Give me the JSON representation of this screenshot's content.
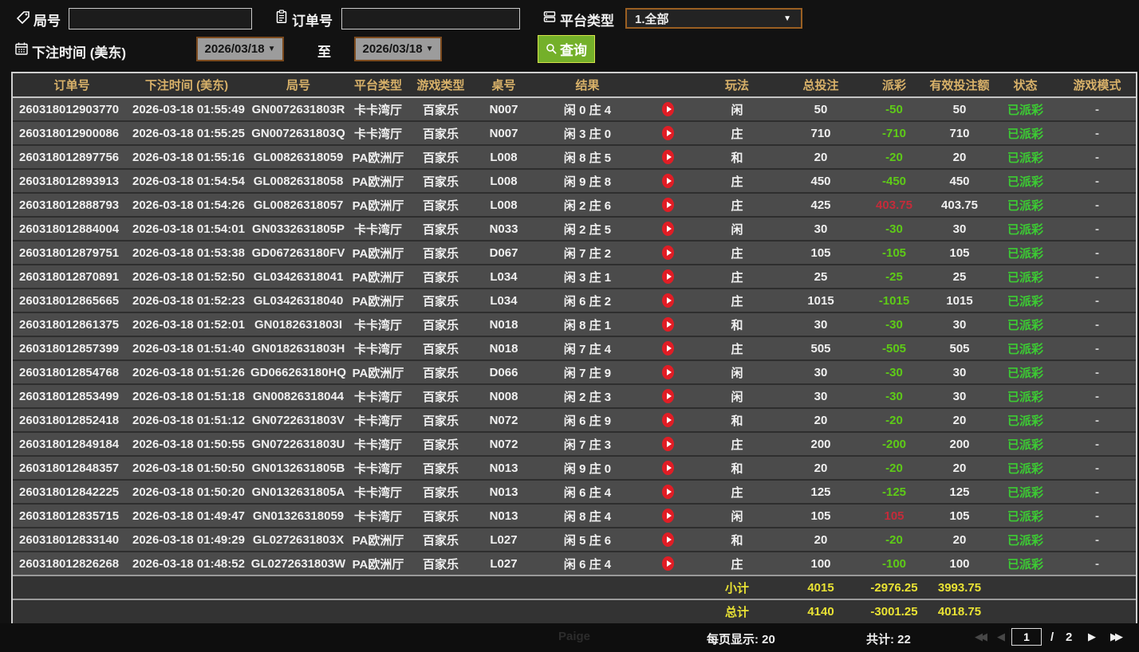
{
  "filters": {
    "game_no_label": "局号",
    "game_no_value": "",
    "order_no_label": "订单号",
    "order_no_value": "",
    "platform_label": "平台类型",
    "platform_value": "1.全部",
    "bet_time_label": "下注时间 (美东)",
    "date_from": "2026/03/18",
    "to_label": "至",
    "date_to": "2026/03/18",
    "query_label": "查询"
  },
  "table": {
    "headers": [
      "订单号",
      "下注时间 (美东)",
      "局号",
      "平台类型",
      "游戏类型",
      "桌号",
      "结果",
      "",
      "玩法",
      "总投注",
      "派彩",
      "有效投注额",
      "状态",
      "游戏模式"
    ],
    "rows": [
      {
        "order": "260318012903770",
        "time": "2026-03-18 01:55:49",
        "game": "GN0072631803R",
        "hall": "卡卡湾厅",
        "type": "百家乐",
        "table": "N007",
        "result": "闲 0 庄 4",
        "play": "闲",
        "bet": "50",
        "pay": "-50",
        "red": false,
        "valid": "50",
        "status": "已派彩",
        "mode": "-"
      },
      {
        "order": "260318012900086",
        "time": "2026-03-18 01:55:25",
        "game": "GN0072631803Q",
        "hall": "卡卡湾厅",
        "type": "百家乐",
        "table": "N007",
        "result": "闲 3 庄 0",
        "play": "庄",
        "bet": "710",
        "pay": "-710",
        "red": false,
        "valid": "710",
        "status": "已派彩",
        "mode": "-"
      },
      {
        "order": "260318012897756",
        "time": "2026-03-18 01:55:16",
        "game": "GL00826318059",
        "hall": "PA欧洲厅",
        "type": "百家乐",
        "table": "L008",
        "result": "闲 8 庄 5",
        "play": "和",
        "bet": "20",
        "pay": "-20",
        "red": false,
        "valid": "20",
        "status": "已派彩",
        "mode": "-"
      },
      {
        "order": "260318012893913",
        "time": "2026-03-18 01:54:54",
        "game": "GL00826318058",
        "hall": "PA欧洲厅",
        "type": "百家乐",
        "table": "L008",
        "result": "闲 9 庄 8",
        "play": "庄",
        "bet": "450",
        "pay": "-450",
        "red": false,
        "valid": "450",
        "status": "已派彩",
        "mode": "-"
      },
      {
        "order": "260318012888793",
        "time": "2026-03-18 01:54:26",
        "game": "GL00826318057",
        "hall": "PA欧洲厅",
        "type": "百家乐",
        "table": "L008",
        "result": "闲 2 庄 6",
        "play": "庄",
        "bet": "425",
        "pay": "403.75",
        "red": true,
        "valid": "403.75",
        "status": "已派彩",
        "mode": "-"
      },
      {
        "order": "260318012884004",
        "time": "2026-03-18 01:54:01",
        "game": "GN0332631805P",
        "hall": "卡卡湾厅",
        "type": "百家乐",
        "table": "N033",
        "result": "闲 2 庄 5",
        "play": "闲",
        "bet": "30",
        "pay": "-30",
        "red": false,
        "valid": "30",
        "status": "已派彩",
        "mode": "-"
      },
      {
        "order": "260318012879751",
        "time": "2026-03-18 01:53:38",
        "game": "GD067263180FV",
        "hall": "PA欧洲厅",
        "type": "百家乐",
        "table": "D067",
        "result": "闲 7 庄 2",
        "play": "庄",
        "bet": "105",
        "pay": "-105",
        "red": false,
        "valid": "105",
        "status": "已派彩",
        "mode": "-"
      },
      {
        "order": "260318012870891",
        "time": "2026-03-18 01:52:50",
        "game": "GL03426318041",
        "hall": "PA欧洲厅",
        "type": "百家乐",
        "table": "L034",
        "result": "闲 3 庄 1",
        "play": "庄",
        "bet": "25",
        "pay": "-25",
        "red": false,
        "valid": "25",
        "status": "已派彩",
        "mode": "-"
      },
      {
        "order": "260318012865665",
        "time": "2026-03-18 01:52:23",
        "game": "GL03426318040",
        "hall": "PA欧洲厅",
        "type": "百家乐",
        "table": "L034",
        "result": "闲 6 庄 2",
        "play": "庄",
        "bet": "1015",
        "pay": "-1015",
        "red": false,
        "valid": "1015",
        "status": "已派彩",
        "mode": "-"
      },
      {
        "order": "260318012861375",
        "time": "2026-03-18 01:52:01",
        "game": "GN0182631803I",
        "hall": "卡卡湾厅",
        "type": "百家乐",
        "table": "N018",
        "result": "闲 8 庄 1",
        "play": "和",
        "bet": "30",
        "pay": "-30",
        "red": false,
        "valid": "30",
        "status": "已派彩",
        "mode": "-"
      },
      {
        "order": "260318012857399",
        "time": "2026-03-18 01:51:40",
        "game": "GN0182631803H",
        "hall": "卡卡湾厅",
        "type": "百家乐",
        "table": "N018",
        "result": "闲 7 庄 4",
        "play": "庄",
        "bet": "505",
        "pay": "-505",
        "red": false,
        "valid": "505",
        "status": "已派彩",
        "mode": "-"
      },
      {
        "order": "260318012854768",
        "time": "2026-03-18 01:51:26",
        "game": "GD066263180HQ",
        "hall": "PA欧洲厅",
        "type": "百家乐",
        "table": "D066",
        "result": "闲 7 庄 9",
        "play": "闲",
        "bet": "30",
        "pay": "-30",
        "red": false,
        "valid": "30",
        "status": "已派彩",
        "mode": "-"
      },
      {
        "order": "260318012853499",
        "time": "2026-03-18 01:51:18",
        "game": "GN00826318044",
        "hall": "卡卡湾厅",
        "type": "百家乐",
        "table": "N008",
        "result": "闲 2 庄 3",
        "play": "闲",
        "bet": "30",
        "pay": "-30",
        "red": false,
        "valid": "30",
        "status": "已派彩",
        "mode": "-"
      },
      {
        "order": "260318012852418",
        "time": "2026-03-18 01:51:12",
        "game": "GN0722631803V",
        "hall": "卡卡湾厅",
        "type": "百家乐",
        "table": "N072",
        "result": "闲 6 庄 9",
        "play": "和",
        "bet": "20",
        "pay": "-20",
        "red": false,
        "valid": "20",
        "status": "已派彩",
        "mode": "-"
      },
      {
        "order": "260318012849184",
        "time": "2026-03-18 01:50:55",
        "game": "GN0722631803U",
        "hall": "卡卡湾厅",
        "type": "百家乐",
        "table": "N072",
        "result": "闲 7 庄 3",
        "play": "庄",
        "bet": "200",
        "pay": "-200",
        "red": false,
        "valid": "200",
        "status": "已派彩",
        "mode": "-"
      },
      {
        "order": "260318012848357",
        "time": "2026-03-18 01:50:50",
        "game": "GN0132631805B",
        "hall": "卡卡湾厅",
        "type": "百家乐",
        "table": "N013",
        "result": "闲 9 庄 0",
        "play": "和",
        "bet": "20",
        "pay": "-20",
        "red": false,
        "valid": "20",
        "status": "已派彩",
        "mode": "-"
      },
      {
        "order": "260318012842225",
        "time": "2026-03-18 01:50:20",
        "game": "GN0132631805A",
        "hall": "卡卡湾厅",
        "type": "百家乐",
        "table": "N013",
        "result": "闲 6 庄 4",
        "play": "庄",
        "bet": "125",
        "pay": "-125",
        "red": false,
        "valid": "125",
        "status": "已派彩",
        "mode": "-"
      },
      {
        "order": "260318012835715",
        "time": "2026-03-18 01:49:47",
        "game": "GN01326318059",
        "hall": "卡卡湾厅",
        "type": "百家乐",
        "table": "N013",
        "result": "闲 8 庄 4",
        "play": "闲",
        "bet": "105",
        "pay": "105",
        "red": true,
        "valid": "105",
        "status": "已派彩",
        "mode": "-"
      },
      {
        "order": "260318012833140",
        "time": "2026-03-18 01:49:29",
        "game": "GL0272631803X",
        "hall": "PA欧洲厅",
        "type": "百家乐",
        "table": "L027",
        "result": "闲 5 庄 6",
        "play": "和",
        "bet": "20",
        "pay": "-20",
        "red": false,
        "valid": "20",
        "status": "已派彩",
        "mode": "-"
      },
      {
        "order": "260318012826268",
        "time": "2026-03-18 01:48:52",
        "game": "GL0272631803W",
        "hall": "PA欧洲厅",
        "type": "百家乐",
        "table": "L027",
        "result": "闲 6 庄 4",
        "play": "庄",
        "bet": "100",
        "pay": "-100",
        "red": false,
        "valid": "100",
        "status": "已派彩",
        "mode": "-"
      }
    ],
    "subtotal": {
      "label": "小计",
      "bet": "4015",
      "pay": "-2976.25",
      "valid": "3993.75"
    },
    "total": {
      "label": "总计",
      "bet": "4140",
      "pay": "-3001.25",
      "valid": "4018.75"
    }
  },
  "footer": {
    "per_page_label": "每页显示: 20",
    "total_count_label": "共计: 22",
    "first_icon": "◀◀",
    "prev_icon": "◀",
    "page_value": "1",
    "page_sep": "/",
    "total_pages": "2",
    "next_icon": "▶",
    "last_icon": "▶▶",
    "background_artifact": "Paige"
  },
  "colors": {
    "header_gold": "#d8b169",
    "payout_green": "#5ecb17",
    "payout_red": "#c52b3a",
    "status_green": "#3ccc33",
    "summary_yellow": "#e9e234",
    "button_green": "#74b02a",
    "date_btn_bg": "#9c9c9c",
    "date_btn_border": "#7b4a1e",
    "dropdown_border": "#9a5f22",
    "row_bg": "#4b4b4b",
    "header_bg": "#2f2f2f",
    "summary_bg": "#333333",
    "table_border": "#cfcfcf",
    "bg": "#121212"
  }
}
